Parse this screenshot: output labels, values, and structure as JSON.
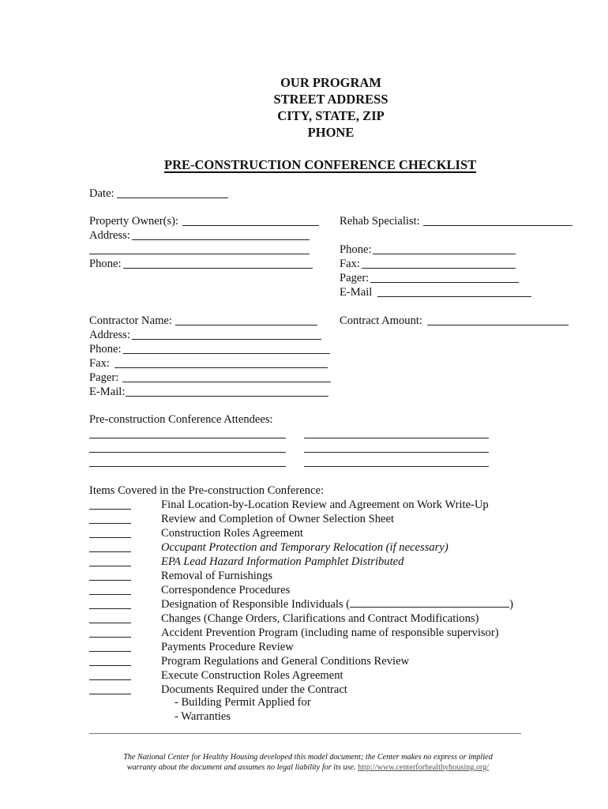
{
  "header": {
    "lines": [
      "OUR PROGRAM",
      "STREET ADDRESS",
      "CITY, STATE, ZIP",
      "PHONE"
    ],
    "title": "PRE-CONSTRUCTION CONFERENCE CHECKLIST"
  },
  "form": {
    "date_label": "Date:",
    "owner": {
      "property_owner_label": "Property Owner(s):",
      "address_label": "Address:",
      "phone_label": "Phone:"
    },
    "rehab": {
      "specialist_label": "Rehab Specialist:",
      "phone_label": "Phone:",
      "fax_label": "Fax:",
      "pager_label": "Pager:",
      "email_label": "E-Mail"
    },
    "contractor": {
      "name_label": "Contractor Name:",
      "address_label": "Address:",
      "phone_label": "Phone:",
      "fax_label": "Fax:",
      "pager_label": "Pager:",
      "email_label": "E-Mail:"
    },
    "contract_amount_label": "Contract Amount:",
    "attendees_label": "Pre-construction Conference Attendees:"
  },
  "checklist": {
    "heading": "Items Covered in the Pre-construction Conference:",
    "items": [
      {
        "label": "Final Location-by-Location Review and Agreement on Work Write-Up",
        "italic": false
      },
      {
        "label": "Review and Completion of Owner Selection Sheet",
        "italic": false
      },
      {
        "label": "Construction Roles Agreement",
        "italic": false
      },
      {
        "label": "Occupant Protection and Temporary Relocation (if necessary)",
        "italic": true
      },
      {
        "label": "EPA Lead Hazard Information Pamphlet Distributed",
        "italic": true
      },
      {
        "label": "Removal of Furnishings",
        "italic": false
      },
      {
        "label": "Correspondence Procedures",
        "italic": false
      },
      {
        "label": "Designation of Responsible Individuals (",
        "italic": false,
        "suffix": ")"
      },
      {
        "label": "Changes (Change Orders, Clarifications and Contract Modifications)",
        "italic": false
      },
      {
        "label": "Accident Prevention Program (including name of responsible supervisor)",
        "italic": false
      },
      {
        "label": "Payments Procedure Review",
        "italic": false
      },
      {
        "label": "Program Regulations and General Conditions Review",
        "italic": false
      },
      {
        "label": "Execute Construction Roles Agreement",
        "italic": false
      },
      {
        "label": "Documents Required under the Contract",
        "italic": false
      }
    ],
    "sub_items": [
      "-  Building Permit Applied for",
      "-  Warranties"
    ]
  },
  "footer": {
    "text_line1": "The National Center for Healthy Housing developed this model document; the Center makes no express or implied",
    "text_line2": "warranty about the document and assumes no legal liability for its use.",
    "link": "http://www.centerforhealthyhousing.org/"
  }
}
